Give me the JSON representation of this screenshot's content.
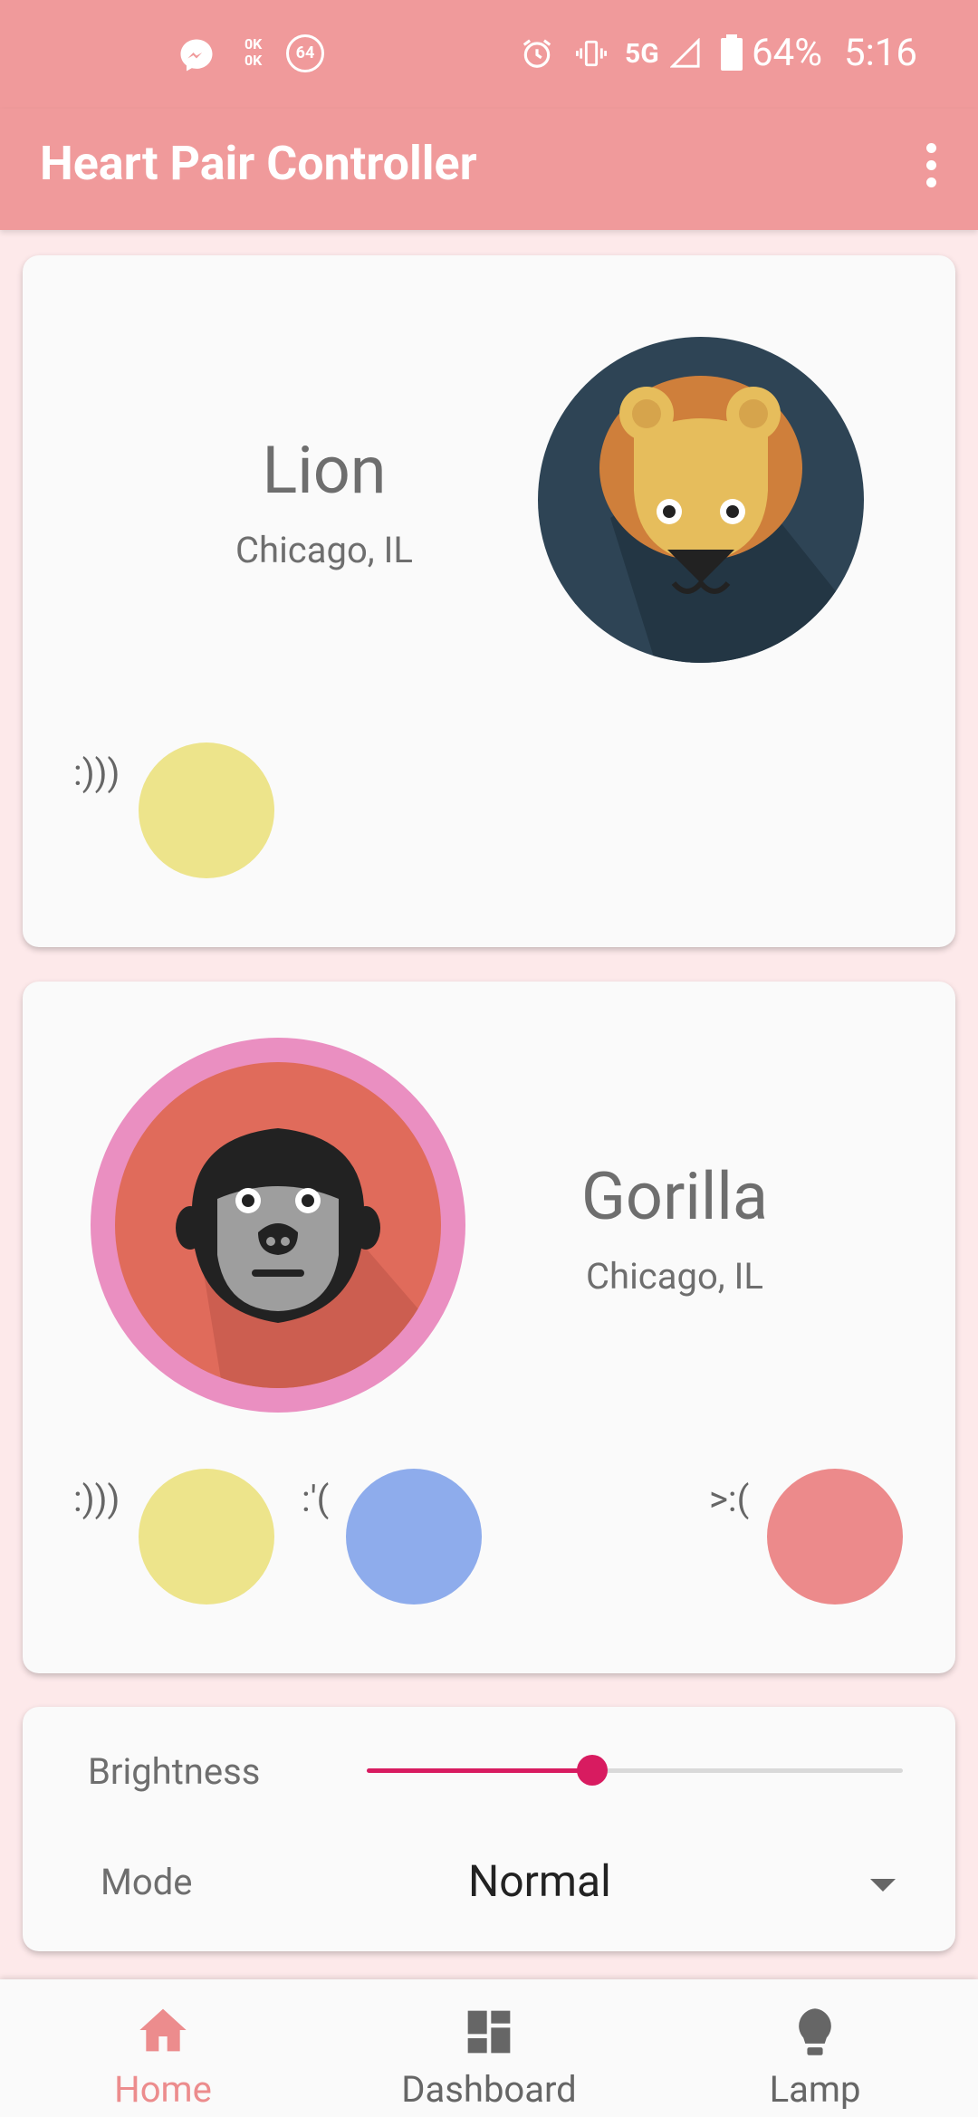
{
  "status_bar": {
    "left_icons": [
      "messenger-icon",
      "data-speed-icon",
      "notification-count-icon"
    ],
    "data_speed": "0K\n0K",
    "notification_count": "64",
    "network": "5G",
    "battery": "64%",
    "time": "5:16"
  },
  "app_bar": {
    "title": "Heart Pair Controller"
  },
  "cards": [
    {
      "name": "Lion",
      "location": "Chicago, IL",
      "emotes": [
        {
          "label": ":)))",
          "color": "#ede48b"
        }
      ]
    },
    {
      "name": "Gorilla",
      "location": "Chicago, IL",
      "emotes": [
        {
          "label": ":)))",
          "color": "#ede48b"
        },
        {
          "label": ":'(",
          "color": "#8eacec"
        },
        {
          "label": ">:(",
          "color": "#ec8a8b"
        }
      ]
    }
  ],
  "controls": {
    "brightness_label": "Brightness",
    "brightness_value": 0.42,
    "mode_label": "Mode",
    "mode_value": "Normal"
  },
  "bottom_nav": {
    "items": [
      {
        "label": "Home",
        "icon": "home-icon",
        "active": true
      },
      {
        "label": "Dashboard",
        "icon": "dashboard-icon",
        "active": false
      },
      {
        "label": "Lamp",
        "icon": "lamp-icon",
        "active": false
      }
    ]
  },
  "colors": {
    "primary": "#f09a9b",
    "background": "#fde9ea",
    "accent": "#d81b60"
  }
}
